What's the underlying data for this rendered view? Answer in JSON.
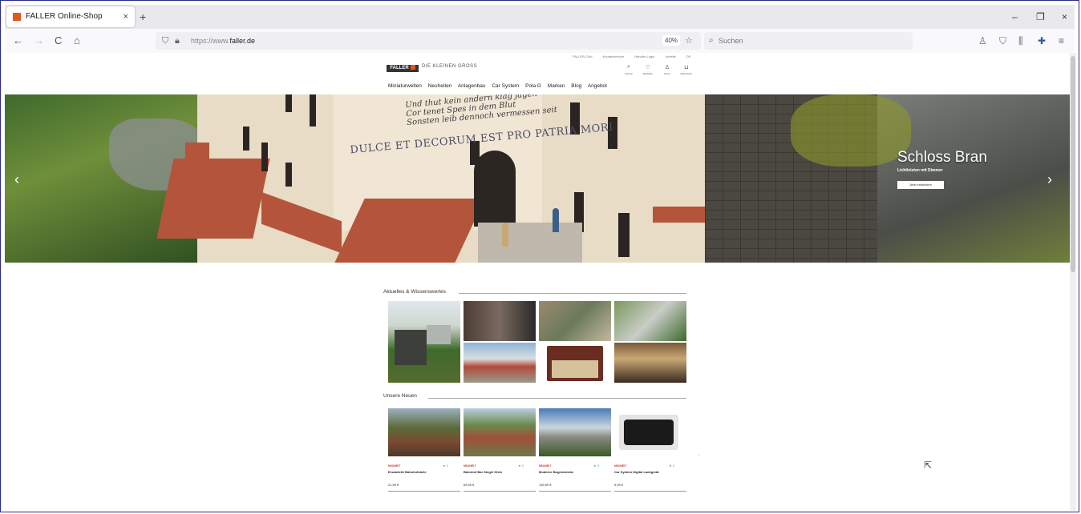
{
  "browser": {
    "tab_title": "FALLER Online-Shop",
    "tab_close": "×",
    "new_tab": "+",
    "url_prefix": "https://www.",
    "url_domain": "faller.de",
    "zoom": "40%",
    "search_placeholder": "Suchen",
    "window_controls": {
      "minimize": "–",
      "restore": "❐",
      "close": "×"
    },
    "nav": {
      "back": "←",
      "forward": "→",
      "reload": "C",
      "home": "⌂"
    }
  },
  "site": {
    "logo": "FALLER",
    "slogan": "DIE KLEINEN GROSS",
    "top_meta": [
      "FALLER-Club",
      "Kundenservice",
      "Händler-Login",
      "Vorteile",
      "DE"
    ],
    "header_icons": [
      {
        "icon": "search-icon",
        "glyph": "⌕",
        "label": "Suchen"
      },
      {
        "icon": "heart-icon",
        "glyph": "♡",
        "label": "Merkliste"
      },
      {
        "icon": "user-icon",
        "glyph": "♙",
        "label": "Konto"
      },
      {
        "icon": "cart-icon",
        "glyph": "⊔",
        "label": "Warenkorb"
      }
    ],
    "main_nav": [
      "Miniaturwelten",
      "Neuheiten",
      "Anlagenbau",
      "Car System",
      "Pola G",
      "Marken",
      "Blog",
      "Angebot"
    ]
  },
  "hero": {
    "title": "Schloss Bran",
    "subtitle": "Lichtleisten mit Dimmer",
    "button": "Jetzt entdecken",
    "motto": "DULCE ET DECORUM EST PRO PATRIA MORI",
    "gothic_lines": [
      "Und thut kein andern klag jagen",
      "Cor tenet Spes in dem Blut",
      "Sonsten leib dennoch vermessen seit"
    ],
    "prev": "‹",
    "next": "›"
  },
  "sections": {
    "news": "Aktuelles & Wissenswertes",
    "new_products": "Unsere Neuen"
  },
  "products": [
    {
      "badge": "NEUHEIT",
      "stars": "★ 0",
      "name": "Ersatzteile Bahnhofsteile",
      "price": "21,99 €"
    },
    {
      "badge": "NEUHEIT",
      "stars": "★ 0",
      "name": "Bahnhof Bar Stegel Gleis",
      "price": "69,99 €"
    },
    {
      "badge": "NEUHEIT",
      "stars": "★ 0",
      "name": "Moderne Bogenbrücke",
      "price": "139,99 €"
    },
    {
      "badge": "NEUHEIT",
      "stars": "★ 0",
      "name": "Car System Digital Ladegerät",
      "price": "9,99 €"
    }
  ],
  "colors": {
    "brand": "#e8541e",
    "dark": "#333333",
    "badge": "#c0392b"
  }
}
